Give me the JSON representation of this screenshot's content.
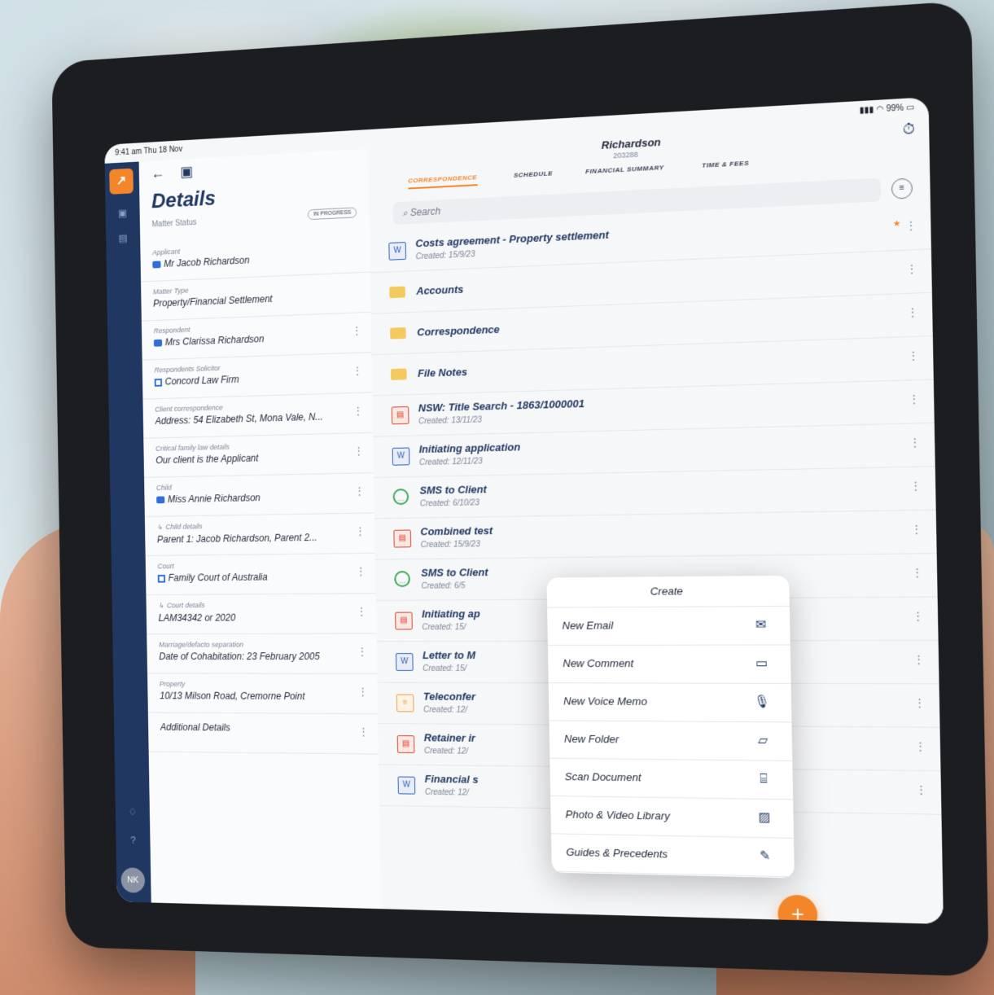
{
  "status": {
    "time": "9:41 am  Thu 18 Nov",
    "battery": "99%"
  },
  "sidebar": {
    "avatar_initials": "NK"
  },
  "details": {
    "title": "Details",
    "matter_status_label": "Matter Status",
    "matter_status_value": "IN PROGRESS",
    "fields": [
      {
        "label": "Applicant",
        "value": "Mr Jacob Richardson",
        "icon": "contact-icon"
      },
      {
        "label": "Matter Type",
        "value": "Property/Financial Settlement"
      },
      {
        "label": "Respondent",
        "value": "Mrs Clarissa Richardson",
        "icon": "contact-icon"
      },
      {
        "label": "Respondents Solicitor",
        "value": "Concord Law Firm",
        "icon": "building-icon"
      },
      {
        "label": "Client correspondence",
        "value": "Address: 54 Elizabeth St, Mona Vale, N..."
      },
      {
        "label": "Critical family law details",
        "value": "Our client is the Applicant"
      },
      {
        "label": "Child",
        "value": "Miss Annie Richardson",
        "icon": "contact-icon"
      },
      {
        "label": "Child details",
        "value": "Parent 1: Jacob Richardson, Parent 2...",
        "sub": true
      },
      {
        "label": "Court",
        "value": "Family Court of Australia",
        "icon": "building-icon"
      },
      {
        "label": "Court details",
        "value": "LAM34342 or 2020",
        "sub": true
      },
      {
        "label": "Marriage/defacto separation",
        "value": "Date of Cohabitation: 23 February 2005"
      },
      {
        "label": "Property",
        "value": "10/13 Milson Road, Cremorne Point"
      },
      {
        "label": "",
        "value": "Additional Details"
      }
    ]
  },
  "matter": {
    "name": "Richardson",
    "number": "203288"
  },
  "tabs": [
    "CORRESPONDENCE",
    "SCHEDULE",
    "FINANCIAL SUMMARY",
    "TIME & FEES"
  ],
  "search": {
    "placeholder": "Search"
  },
  "items": [
    {
      "name": "Costs agreement - Property settlement",
      "created": "Created: 15/9/23",
      "type": "doc"
    },
    {
      "name": "Accounts",
      "created": "",
      "type": "folder"
    },
    {
      "name": "Correspondence",
      "created": "",
      "type": "folder"
    },
    {
      "name": "File Notes",
      "created": "",
      "type": "folder"
    },
    {
      "name": "NSW: Title Search - 1863/1000001",
      "created": "Created: 13/11/23",
      "type": "pdf"
    },
    {
      "name": "Initiating application",
      "created": "Created: 12/11/23",
      "type": "doc"
    },
    {
      "name": "SMS to Client",
      "created": "Created: 6/10/23",
      "type": "sms"
    },
    {
      "name": "Combined test",
      "created": "Created: 15/9/23",
      "type": "pdf"
    },
    {
      "name": "SMS to Client",
      "created": "Created: 6/5",
      "type": "sms"
    },
    {
      "name": "Initiating ap",
      "created": "Created: 15/",
      "type": "pdf"
    },
    {
      "name": "Letter to M",
      "created": "Created: 15/",
      "type": "doc"
    },
    {
      "name": "Teleconfer",
      "created": "Created: 12/",
      "type": "note"
    },
    {
      "name": "Retainer ir",
      "created": "Created: 12/",
      "type": "pdf"
    },
    {
      "name": "Financial s",
      "created": "Created: 12/",
      "type": "doc"
    }
  ],
  "create_menu": {
    "title": "Create",
    "items": [
      {
        "label": "New Email",
        "icon": "email-add-icon"
      },
      {
        "label": "New Comment",
        "icon": "comment-add-icon"
      },
      {
        "label": "New Voice Memo",
        "icon": "voice-memo-icon"
      },
      {
        "label": "New Folder",
        "icon": "folder-add-icon"
      },
      {
        "label": "Scan Document",
        "icon": "scan-icon"
      },
      {
        "label": "Photo & Video Library",
        "icon": "photo-icon"
      },
      {
        "label": "Guides & Precedents",
        "icon": "guides-icon"
      }
    ]
  },
  "colors": {
    "brand": "#1f3761",
    "accent": "#f3862a"
  }
}
